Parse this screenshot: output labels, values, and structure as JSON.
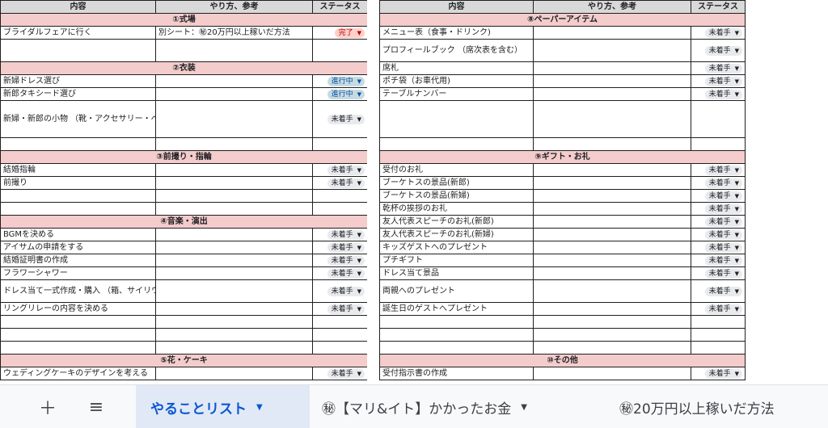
{
  "headers": {
    "content": "内容",
    "method": "やり方、参考",
    "status": "ステータス"
  },
  "left_table": [
    {
      "type": "section",
      "title": "①式場"
    },
    {
      "type": "item",
      "content": "ブライダルフェアに行く",
      "method": "別シート：㊙20万円以上稼いだ方法",
      "status": "完了",
      "status_class": "st-done"
    },
    {
      "type": "blank",
      "h": 28
    },
    {
      "type": "section",
      "title": "②衣装"
    },
    {
      "type": "item",
      "content": "新婦ドレス選び",
      "status": "進行中",
      "status_class": "st-prog"
    },
    {
      "type": "item",
      "content": "新郎タキシード選び",
      "status": "進行中",
      "status_class": "st-prog"
    },
    {
      "type": "item",
      "content": "新婦・新郎の小物\n（靴・アクセサリー・ベール・\nネクタイ・カフスなど）",
      "status": "未着手",
      "status_class": "st-none",
      "h": 46
    },
    {
      "type": "blank"
    },
    {
      "type": "section",
      "title": "③前撮り・指輪"
    },
    {
      "type": "item",
      "content": "結婚指輪",
      "status": "未着手",
      "status_class": "st-none"
    },
    {
      "type": "item",
      "content": "前撮り",
      "status": "未着手",
      "status_class": "st-none"
    },
    {
      "type": "blank"
    },
    {
      "type": "blank"
    },
    {
      "type": "section",
      "title": "④音楽・演出"
    },
    {
      "type": "item",
      "content": "BGMを決める",
      "status": "未着手",
      "status_class": "st-none"
    },
    {
      "type": "item",
      "content": "アイサムの申請をする",
      "status": "未着手",
      "status_class": "st-none"
    },
    {
      "type": "item",
      "content": "結婚証明書の作成",
      "status": "未着手",
      "status_class": "st-none"
    },
    {
      "type": "item",
      "content": "フラワーシャワー",
      "status": "未着手",
      "status_class": "st-none"
    },
    {
      "type": "item",
      "content": "ドレス当て一式作成・購入\n（箱、サイリウム、説明書）",
      "status": "未着手",
      "status_class": "st-none",
      "h": 28
    },
    {
      "type": "item",
      "content": "リングリレーの内容を決める",
      "status": "未着手",
      "status_class": "st-none"
    },
    {
      "type": "blank"
    },
    {
      "type": "blank"
    },
    {
      "type": "blank"
    },
    {
      "type": "section",
      "title": "⑤花・ケーキ"
    },
    {
      "type": "item",
      "content": "ウェディングケーキのデザインを考える",
      "status": "未着手",
      "status_class": "st-none"
    }
  ],
  "right_table": [
    {
      "type": "section",
      "title": "⑧ペーパーアイテム"
    },
    {
      "type": "item",
      "content": "メニュー表（食事・ドリンク)",
      "status": "未着手",
      "status_class": "st-none"
    },
    {
      "type": "item",
      "content": "プロフィールブック\n（席次表を含む）",
      "status": "未着手",
      "status_class": "st-none",
      "h": 28
    },
    {
      "type": "item",
      "content": "席札",
      "status": "未着手",
      "status_class": "st-none"
    },
    {
      "type": "item",
      "content": "ポチ袋（お車代用)",
      "status": "未着手",
      "status_class": "st-none"
    },
    {
      "type": "item",
      "content": "テーブルナンバー",
      "status": "未着手",
      "status_class": "st-none"
    },
    {
      "type": "blank",
      "h": 46
    },
    {
      "type": "blank"
    },
    {
      "type": "section",
      "title": "⑨ギフト・お礼"
    },
    {
      "type": "item",
      "content": "受付のお礼",
      "status": "未着手",
      "status_class": "st-none"
    },
    {
      "type": "item",
      "content": "ブーケトスの景品(新郎)",
      "status": "未着手",
      "status_class": "st-none"
    },
    {
      "type": "item",
      "content": "ブーケトスの景品(新婦)",
      "status": "未着手",
      "status_class": "st-none"
    },
    {
      "type": "item",
      "content": "乾杯の挨拶のお礼",
      "status": "未着手",
      "status_class": "st-none"
    },
    {
      "type": "item",
      "content": "友人代表スピーチのお礼(新郎)",
      "status": "未着手",
      "status_class": "st-none"
    },
    {
      "type": "item",
      "content": "友人代表スピーチのお礼(新婦)",
      "status": "未着手",
      "status_class": "st-none"
    },
    {
      "type": "item",
      "content": "キッズゲストへのプレゼント",
      "status": "未着手",
      "status_class": "st-none"
    },
    {
      "type": "item",
      "content": "プチギフト",
      "status": "未着手",
      "status_class": "st-none"
    },
    {
      "type": "item",
      "content": "ドレス当て景品",
      "status": "未着手",
      "status_class": "st-none"
    },
    {
      "type": "item",
      "content": "両親へのプレゼント",
      "status": "未着手",
      "status_class": "st-none",
      "h": 28
    },
    {
      "type": "item",
      "content": "誕生日のゲストへプレゼント",
      "status": "未着手",
      "status_class": "st-none"
    },
    {
      "type": "blank"
    },
    {
      "type": "blank"
    },
    {
      "type": "blank"
    },
    {
      "type": "section",
      "title": "⑩その他"
    },
    {
      "type": "item",
      "content": "受付指示書の作成",
      "status": "未着手",
      "status_class": "st-none"
    }
  ],
  "tabbar": {
    "add_icon": "＋",
    "menu_icon": "≡",
    "tabs": [
      {
        "label": "やることリスト",
        "caret": "▼"
      },
      {
        "label": "㊙【マリ&イト】かかったお金",
        "caret": "▼"
      },
      {
        "label": "㊙20万円以上稼いだ方法"
      }
    ]
  }
}
